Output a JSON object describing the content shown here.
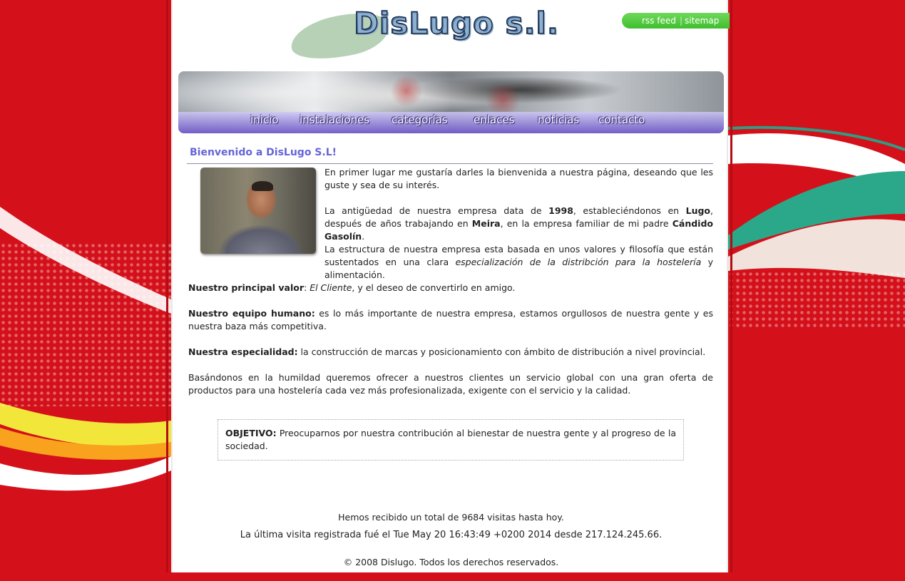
{
  "header": {
    "logo": "DisLugo s.l.",
    "links": {
      "rss": "rss feed",
      "separator": "|",
      "sitemap": "sitemap"
    }
  },
  "nav": [
    {
      "label": "inicio"
    },
    {
      "label": "instalaciones"
    },
    {
      "label": "categorías"
    },
    {
      "label": "enlaces"
    },
    {
      "label": "noticias"
    },
    {
      "label": "contacto"
    }
  ],
  "main": {
    "title": "Bienvenido a DisLugo S.L!",
    "p1": "En primer lugar me gustaría darles la bienvenida a nuestra página, deseando que les guste y sea de su interés.",
    "p2": {
      "t1": "La antigüedad de nuestra empresa data de ",
      "year": "1998",
      "t2": ", estableciéndonos en ",
      "city": "Lugo",
      "t3": ", después de años trabajando en ",
      "town": "Meira",
      "t4": ", en la empresa familiar de mi padre ",
      "father": "Cándido Gasolín",
      "t5": "."
    },
    "p3": {
      "t1": "La estructura de nuestra empresa esta basada en unos valores y filosofía que están sustentados en una clara ",
      "em": "especialización de la distribción para la hostelería",
      "t2": " y alimentación."
    },
    "p4": {
      "label": "Nuestro principal valor",
      "colon": ": ",
      "em": "El Cliente",
      "rest": ", y el deseo de convertirlo en amigo."
    },
    "p5": {
      "label": "Nuestro equipo humano:",
      "rest": " es lo más importante de nuestra empresa, estamos orgullosos de nuestra gente y es nuestra baza más competitiva."
    },
    "p6": {
      "label": "Nuestra especialidad:",
      "rest": " la construcción de marcas y posicionamiento con ámbito de distribución a nivel provincial."
    },
    "p7": "Basándonos en la humildad queremos ofrecer a nuestros clientes un servicio global con una gran oferta de productos para una hostelería cada vez más profesionalizada, exigente con el servicio y la calidad.",
    "objective": {
      "label": "OBJETIVO:",
      "rest": " Preocuparnos por nuestra contribución al bienestar de nuestra gente y al progreso de la sociedad."
    }
  },
  "footer": {
    "visits": "Hemos recibido un total de 9684 visitas hasta hoy.",
    "last_prefix": "La última visita registrada fué el ",
    "last_date": "Tue May 20 16:43:49 +0200 2014",
    "last_mid": " desde ",
    "last_ip": "217.124.245.66",
    "last_end": ".",
    "copy_prefix": "© 2008 ",
    "copy_brand": "Dislugo.",
    "copy_rest": " Todos los derechos reservados."
  },
  "colors": {
    "background": "#d4101a",
    "title": "#6565d8",
    "rss_bar": "#4fca3c",
    "nav_bar": "#705ac8"
  },
  "icons": [
    "logo-swoosh",
    "banner-photo",
    "owner-photo"
  ]
}
